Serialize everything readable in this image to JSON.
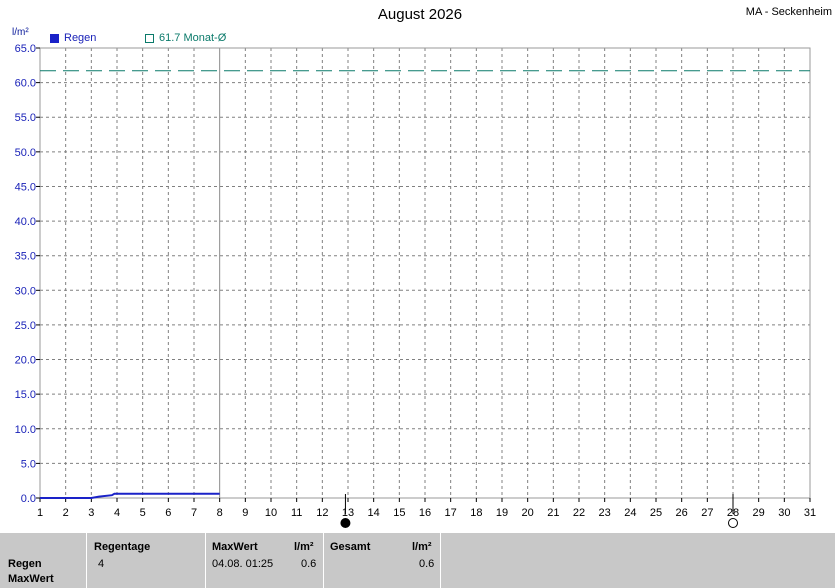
{
  "header": {
    "title": "August 2026",
    "station": "MA - Seckenheim",
    "unit": "l/m²"
  },
  "legend": {
    "rain_label": "Regen",
    "avg_label": "61.7 Monat-Ø"
  },
  "chart_data": {
    "type": "line",
    "title": "August 2026",
    "ylabel": "l/m²",
    "ylim": [
      0,
      65
    ],
    "y_ticks": [
      "0.0",
      "5.0",
      "10.0",
      "15.0",
      "20.0",
      "25.0",
      "30.0",
      "35.0",
      "40.0",
      "45.0",
      "50.0",
      "55.0",
      "60.0",
      "65.0"
    ],
    "x_ticks": [
      "1",
      "2",
      "3",
      "4",
      "5",
      "6",
      "7",
      "8",
      "9",
      "10",
      "11",
      "12",
      "13",
      "14",
      "15",
      "16",
      "17",
      "18",
      "19",
      "20",
      "21",
      "22",
      "23",
      "24",
      "25",
      "26",
      "27",
      "28",
      "29",
      "30",
      "31"
    ],
    "xlim": [
      1,
      31
    ],
    "current_day": 8,
    "grid": true,
    "legend_position": "top-left",
    "series": [
      {
        "name": "Regen",
        "color": "#1a22c8",
        "x": [
          1,
          3,
          3.3,
          3.8,
          3.9,
          8
        ],
        "y": [
          0,
          0,
          0.2,
          0.4,
          0.6,
          0.6
        ]
      },
      {
        "name": "61.7 Monat-Ø",
        "color": "#0a7a6a",
        "style": "dashed",
        "x": [
          1,
          31
        ],
        "y": [
          61.7,
          61.7
        ]
      }
    ],
    "moon_phases": [
      {
        "day": 12.9,
        "phase": "new"
      },
      {
        "day": 28.0,
        "phase": "full"
      }
    ]
  },
  "footer": {
    "row1": "Regen",
    "row2": "MaxWert",
    "regentage_label": "Regentage",
    "regentage_value": "4",
    "maxwert_label": "MaxWert",
    "maxwert_unit": "l/m²",
    "maxwert_date": "04.08.  01:25",
    "maxwert_value": "0.6",
    "gesamt_label": "Gesamt",
    "gesamt_unit": "l/m²",
    "gesamt_value": "0.6"
  }
}
